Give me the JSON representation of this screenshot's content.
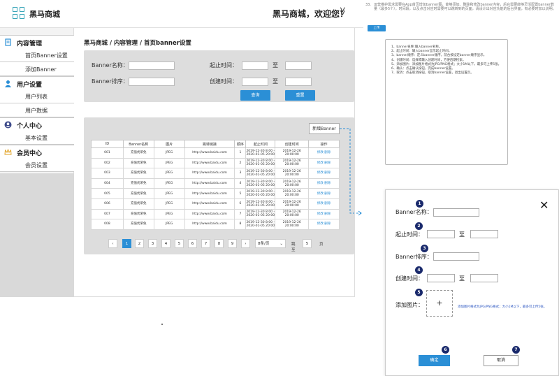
{
  "header": {
    "app_name": "黑马商城",
    "welcome": "黑马商城，欢迎您！",
    "chevron": "≫"
  },
  "sidebar": {
    "groups": [
      {
        "label": "内容管理",
        "icon": "document-icon",
        "items": [
          "首页Banner设置",
          "添加Banner"
        ]
      },
      {
        "label": "用户设置",
        "icon": "user-icon",
        "items": [
          "用户列表",
          "用户数据"
        ]
      },
      {
        "label": "个人中心",
        "icon": "profile-icon",
        "items": [
          "基本设置"
        ]
      },
      {
        "label": "会员中心",
        "icon": "crown-icon",
        "items": [
          "会员设置"
        ]
      }
    ]
  },
  "main": {
    "breadcrumb": "黑马商城 / 内容管理 / 首页banner设置",
    "filter": {
      "name_label": "Banner名称：",
      "start_label": "起止时间：",
      "sort_label": "Banner排序：",
      "created_label": "创建时间：",
      "to1": "至",
      "to2": "至",
      "query_btn": "查询",
      "reset_btn": "重置"
    },
    "new_banner_btn": "新增Banner",
    "table": {
      "headers": [
        "ID",
        "Banner名称",
        "图片",
        "跳转链接",
        "顺序",
        "起止时间",
        "创建时间",
        "操作"
      ],
      "rows": [
        [
          "001",
          "充值优荣免",
          "JPEG",
          "http://www.baidu.com",
          "1",
          "2019-12-30 8:00 -\n2020-01-05 20:00",
          "2019-12-26 20:00:00",
          "修改 删除"
        ],
        [
          "002",
          "充值优荣免",
          "JPEG",
          "http://www.baidu.com",
          "2",
          "2019-12-30 8:00 -\n2020-01-05 20:00",
          "2019-12-26 20:00:00",
          "修改 删除"
        ],
        [
          "003",
          "充值优荣免",
          "JPEG",
          "http://www.baidu.com",
          "3",
          "2019-12-30 8:00 -\n2020-01-05 20:00",
          "2019-12-26 20:00:00",
          "修改 删除"
        ],
        [
          "004",
          "充值优荣免",
          "JPEG",
          "http://www.baidu.com",
          "4",
          "2019-12-30 8:00 -\n2020-01-05 20:00",
          "2019-12-26 20:00:00",
          "修改 删除"
        ],
        [
          "005",
          "充值优荣免",
          "JPEG",
          "http://www.baidu.com",
          "5",
          "2019-12-30 8:00 -\n2020-01-05 20:00",
          "2019-12-26 20:00:00",
          "修改 删除"
        ],
        [
          "006",
          "充值优荣免",
          "JPEG",
          "http://www.baidu.com",
          "6",
          "2019-12-30 8:00 -\n2020-01-05 20:00",
          "2019-12-26 20:00:00",
          "修改 删除"
        ],
        [
          "007",
          "充值优荣免",
          "JPEG",
          "http://www.baidu.com",
          "7",
          "2019-12-30 8:00 -\n2020-01-05 20:00",
          "2019-12-26 20:00:00",
          "修改 删除"
        ],
        [
          "008",
          "充值优荣免",
          "JPEG",
          "http://www.baidu.com",
          "8",
          "2019-12-30 8:00 -\n2020-01-05 20:00",
          "2019-12-26 20:00:00",
          "修改 删除"
        ]
      ]
    },
    "pager": {
      "prev": "‹",
      "pages": [
        "1",
        "2",
        "3",
        "4",
        "5",
        "6",
        "7",
        "8",
        "9"
      ],
      "next": "›",
      "page_size": "8条/页",
      "goto_label": "跳至",
      "goto_value": "5",
      "page_suffix": "页"
    }
  },
  "annotation": {
    "number": "33.",
    "text": "运营维护需求需要在App首页增加banner图，能够添加、删除和修改banner内容，后台需要能够灵活配置banner数量（最多5个），时间段，以及点击对应时需要可以跳转到的页面，请设计出对应功能的后台界面，有必要时加以说明。",
    "upload_btn": "上传",
    "list": [
      "1、banner名称:输入banner名称。",
      "2、起止时间：输入banner显示起止时间。",
      "3、banner顺序：定义banner顺序，前台按设定banner顺序显示。",
      "4、创建时间：选择或输入创建时间，方便后期检索。",
      "5、添加图片：添加图片格式为JPG/PNG格式；大小1M以下，最多可上传5张。",
      "6、确认：点击确认按钮，完成banner设置。",
      "7、取消：点击取消按钮，取消banner设置，退出设置页。"
    ]
  },
  "modal": {
    "close": "✕",
    "name_label": "Banner名称：",
    "start_label": "起止时间：",
    "to1": "至",
    "sort_label": "Banner排序：",
    "created_label": "创建时间：",
    "to2": "至",
    "image_label": "添加图片：",
    "plus": "+",
    "upload_hint": "添加图片格式为JPG/PNG格式；大小1M以下，最多可上传5张。",
    "confirm_btn": "确定",
    "cancel_btn": "取消",
    "badges": [
      "1",
      "2",
      "3",
      "4",
      "5",
      "6",
      "7"
    ]
  },
  "colors": {
    "accent": "#2b8fd6",
    "badge": "#1a2a6c",
    "logo": "#3aa6b9"
  }
}
